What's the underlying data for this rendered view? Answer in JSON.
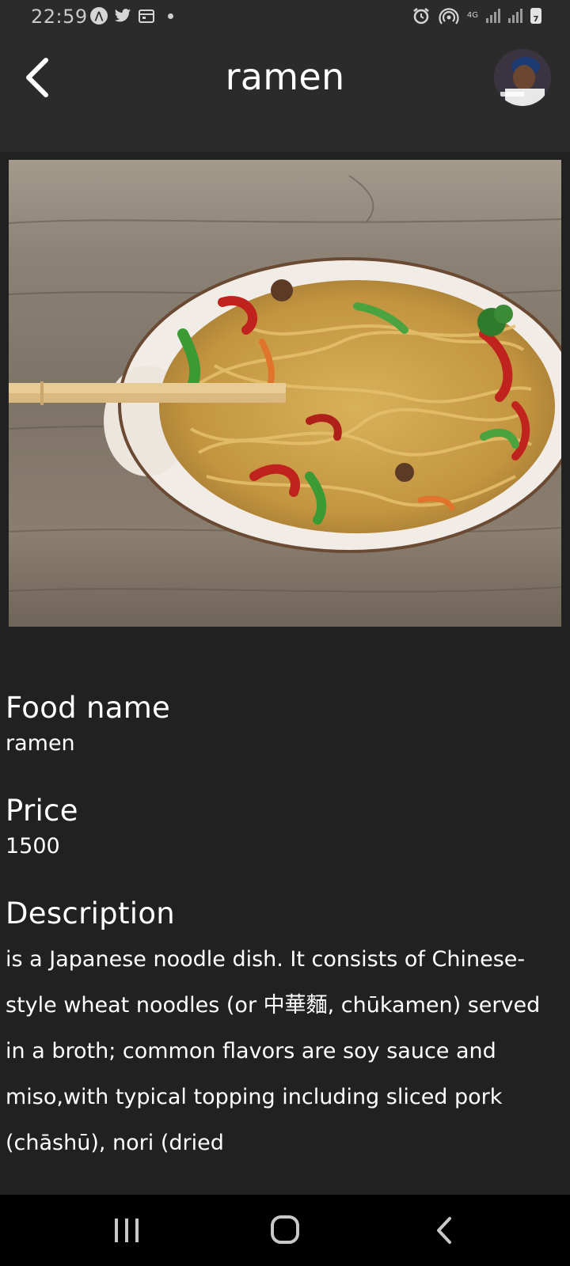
{
  "status_bar": {
    "time": "22:59",
    "network_label": "4G",
    "battery_level": "7"
  },
  "header": {
    "title": "ramen"
  },
  "details": {
    "food_name_label": "Food name",
    "food_name_value": "ramen",
    "price_label": "Price",
    "price_value": "1500",
    "description_label": "Description",
    "description_text": "is a Japanese noodle dish. It consists of Chinese-style wheat noodles (or 中華麵, chūkamen) served in a broth; common flavors are soy sauce and miso,with typical topping including sliced pork (chāshū), nori (dried"
  },
  "colors": {
    "background": "#212121",
    "header_background": "#2b2b2c",
    "text": "#ffffff",
    "nav_background": "#000000"
  }
}
